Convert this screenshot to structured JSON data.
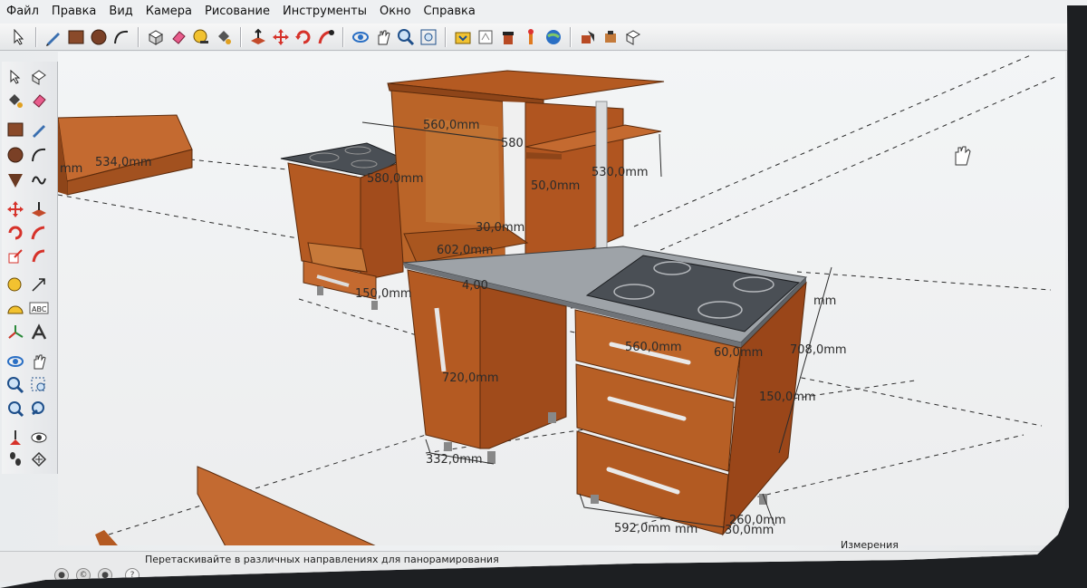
{
  "menu": [
    "Файл",
    "Правка",
    "Вид",
    "Камера",
    "Рисование",
    "Инструменты",
    "Окно",
    "Справка"
  ],
  "toolbar_icons": [
    "select-icon",
    "pencil-icon",
    "rectangle-icon",
    "circle-icon",
    "arc-icon",
    "make-component-icon",
    "eraser-icon",
    "paint-bucket-icon",
    "push-pull-icon",
    "move-icon",
    "rotate-icon",
    "follow-me-icon",
    "offset-icon",
    "orbit-icon",
    "pan-icon",
    "zoom-icon",
    "zoom-extents-icon",
    "get-models-icon",
    "share-model-icon",
    "3d-warehouse-icon",
    "extension-icon",
    "styles-icon",
    "geo-location-icon",
    "shadows-icon",
    "fog-icon",
    "section-icon"
  ],
  "left_tool_icons": [
    "select-icon",
    "make-component-icon",
    "paint-bucket-icon",
    "eraser-icon",
    "rectangle-icon",
    "line-icon",
    "circle-icon",
    "arc-icon",
    "polygon-icon",
    "freehand-icon",
    "move-icon",
    "push-pull-icon",
    "rotate-icon",
    "follow-me-icon",
    "scale-icon",
    "offset-icon",
    "tape-measure-icon",
    "dimension-icon",
    "protractor-icon",
    "text-icon",
    "axes-icon",
    "3d-text-icon",
    "orbit-icon",
    "pan-icon",
    "zoom-icon",
    "zoom-window-icon",
    "zoom-extents-icon",
    "previous-icon",
    "position-camera-icon",
    "look-around-icon",
    "walk-icon",
    "section-plane-icon"
  ],
  "dimensions": {
    "d1": "534,0mm",
    "d2": "560,0mm",
    "d3": "580",
    "d4": "580,0mm",
    "d5": "530,0mm",
    "d6": "50,0mm",
    "d7": "30,0mm",
    "d8": "602,0mm",
    "d9": "150,0mm",
    "d10": "4,00",
    "d11": "720,0mm",
    "d12": "332,0mm",
    "d13": "560,0mm",
    "d14": "60,0mm",
    "d15": "708,0mm",
    "d16": "150,0mm",
    "d17": "592,0mm",
    "d18": "260,0mm",
    "d19": "30,0mm",
    "d20": "mm",
    "d21": "mm",
    "d22": "mm"
  },
  "status": {
    "hint": "Перетаскивайте в различных направлениях для панорамирования",
    "measurements_label": "Измерения"
  },
  "colors": {
    "wood": "#b45a22",
    "wood_dark": "#8a3f14",
    "countertop": "#9ea3a8",
    "hob": "#4a4f55"
  }
}
